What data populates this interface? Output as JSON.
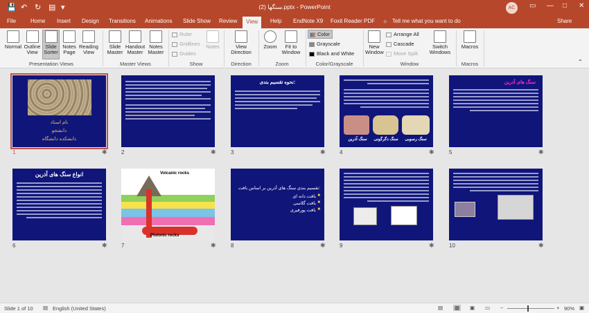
{
  "title_bar": {
    "title": "سنگها (2).pptx  -  PowerPoint",
    "avatar": "AC",
    "save_icon": "save-icon",
    "undo_icon": "undo-icon",
    "redo_icon": "redo-icon",
    "start_icon": "start-from-beginning-icon",
    "customize_icon": "customize-qat-icon",
    "ribbon_options_icon": "ribbon-display-options-icon",
    "min_icon": "minimize-icon",
    "max_icon": "restore-icon",
    "close_icon": "close-icon"
  },
  "tabs": [
    "File",
    "Home",
    "Insert",
    "Design",
    "Transitions",
    "Animations",
    "Slide Show",
    "Review",
    "View",
    "Help",
    "EndNote X9",
    "Foxit Reader PDF"
  ],
  "active_tab": "View",
  "tell_me": "Tell me what you want to do",
  "share": "Share",
  "ribbon": {
    "presentation_views": {
      "label": "Presentation Views",
      "buttons": [
        "Normal",
        "Outline View",
        "Slide Sorter",
        "Notes Page",
        "Reading View"
      ],
      "selected": "Slide Sorter"
    },
    "master_views": {
      "label": "Master Views",
      "buttons": [
        "Slide Master",
        "Handout Master",
        "Notes Master"
      ]
    },
    "show": {
      "label": "Show",
      "items": [
        "Ruler",
        "Gridlines",
        "Guides"
      ],
      "notes": "Notes"
    },
    "direction": {
      "label": "Direction",
      "button": "View Direction"
    },
    "zoom": {
      "label": "Zoom",
      "buttons": [
        "Zoom",
        "Fit to Window"
      ]
    },
    "color": {
      "label": "Color/Grayscale",
      "items": [
        "Color",
        "Grayscale",
        "Black and White"
      ],
      "selected": "Color"
    },
    "window": {
      "label": "Window",
      "new_window": "New Window",
      "items": [
        "Arrange All",
        "Cascade",
        "Move Split"
      ],
      "switch": "Switch Windows"
    },
    "macros": {
      "label": "Macros",
      "button": "Macros"
    }
  },
  "slides": [
    {
      "n": "1",
      "title": "",
      "sub": "نام استاد",
      "sub2": "دانشجو",
      "sub3": "دانشکده دانشگاه",
      "selected": true
    },
    {
      "n": "2",
      "title": "",
      "selected": false
    },
    {
      "n": "3",
      "title": "نحوه تقسیم بندی:",
      "selected": false
    },
    {
      "n": "4",
      "title": "",
      "labels": [
        "سنگ آذرین",
        "سنگ دگرگونی",
        "سنگ رسوبی"
      ],
      "selected": false
    },
    {
      "n": "5",
      "title": "سنگ های آذرین",
      "selected": false
    },
    {
      "n": "6",
      "title": "انواع سنگ های آذرین",
      "selected": false
    },
    {
      "n": "7",
      "title": "Volcanic rocks",
      "sub": "Plutonic rocks",
      "selected": false
    },
    {
      "n": "8",
      "title": "تقسیم بندی سنگ های آذرین بر اساس بافت:",
      "bullets": [
        "بافت دانه ای",
        "بافت گلاسی",
        "بافت پورفیری"
      ],
      "selected": false
    },
    {
      "n": "9",
      "title": "",
      "selected": false
    },
    {
      "n": "10",
      "title": "",
      "selected": false
    }
  ],
  "status": {
    "slide": "Slide 1 of 10",
    "language": "English (United States)",
    "zoom": "90%",
    "zoom_percent": 90
  },
  "colors": {
    "accent": "#b7472a",
    "slide_bg": "#10157a",
    "selection": "#c0504d"
  }
}
